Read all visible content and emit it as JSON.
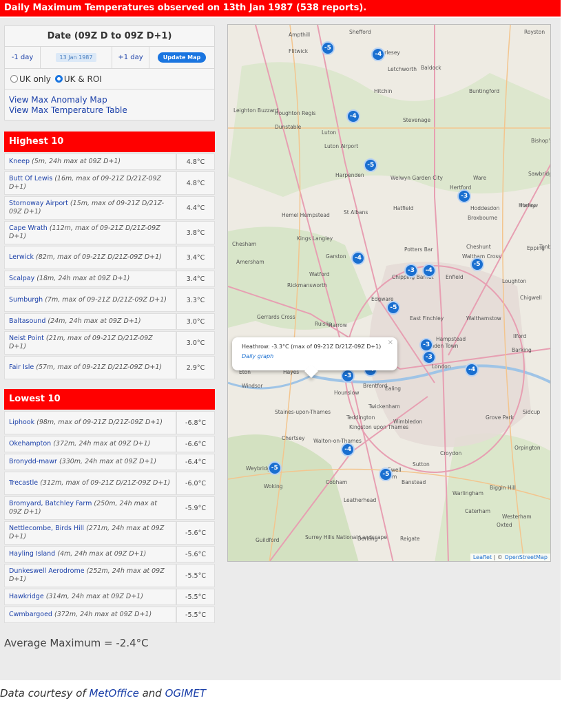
{
  "title": "Daily Maximum Temperatures observed on 13th Jan 1987 (538 reports).",
  "date_panel": {
    "heading": "Date (09Z D to 09Z D+1)",
    "prev": "-1 day",
    "date": "13 Jan 1987",
    "next": "+1 day",
    "update": "Update Map"
  },
  "region": {
    "opt1": "UK only",
    "opt2": "UK & ROI",
    "selected": "UK & ROI"
  },
  "links": {
    "anomaly": "View Max Anomaly Map",
    "table": "View Max Temperature Table"
  },
  "highest": {
    "heading": "Highest 10",
    "rows": [
      {
        "name": "Kneep",
        "desc": "(5m, 24h max at 09Z D+1)",
        "value": "4.8°C"
      },
      {
        "name": "Butt Of Lewis",
        "desc": "(16m, max of 09-21Z D/21Z-09Z D+1)",
        "value": "4.8°C"
      },
      {
        "name": "Stornoway Airport",
        "desc": "(15m, max of 09-21Z D/21Z-09Z D+1)",
        "value": "4.4°C"
      },
      {
        "name": "Cape Wrath",
        "desc": "(112m, max of 09-21Z D/21Z-09Z D+1)",
        "value": "3.8°C"
      },
      {
        "name": "Lerwick",
        "desc": "(82m, max of 09-21Z D/21Z-09Z D+1)",
        "value": "3.4°C"
      },
      {
        "name": "Scalpay",
        "desc": "(18m, 24h max at 09Z D+1)",
        "value": "3.4°C"
      },
      {
        "name": "Sumburgh",
        "desc": "(7m, max of 09-21Z D/21Z-09Z D+1)",
        "value": "3.3°C"
      },
      {
        "name": "Baltasound",
        "desc": "(24m, 24h max at 09Z D+1)",
        "value": "3.0°C"
      },
      {
        "name": "Neist Point",
        "desc": "(21m, max of 09-21Z D/21Z-09Z D+1)",
        "value": "3.0°C"
      },
      {
        "name": "Fair Isle",
        "desc": "(57m, max of 09-21Z D/21Z-09Z D+1)",
        "value": "2.9°C"
      }
    ]
  },
  "lowest": {
    "heading": "Lowest 10",
    "rows": [
      {
        "name": "Liphook",
        "desc": "(98m, max of 09-21Z D/21Z-09Z D+1)",
        "value": "-6.8°C"
      },
      {
        "name": "Okehampton",
        "desc": "(372m, 24h max at 09Z D+1)",
        "value": "-6.6°C"
      },
      {
        "name": "Bronydd-mawr",
        "desc": "(330m, 24h max at 09Z D+1)",
        "value": "-6.4°C"
      },
      {
        "name": "Trecastle",
        "desc": "(312m, max of 09-21Z D/21Z-09Z D+1)",
        "value": "-6.0°C"
      },
      {
        "name": "Bromyard, Batchley Farm",
        "desc": "(250m, 24h max at 09Z D+1)",
        "value": "-5.9°C"
      },
      {
        "name": "Nettlecombe, Birds Hill",
        "desc": "(271m, 24h max at 09Z D+1)",
        "value": "-5.6°C"
      },
      {
        "name": "Hayling Island",
        "desc": "(4m, 24h max at 09Z D+1)",
        "value": "-5.6°C"
      },
      {
        "name": "Dunkeswell Aerodrome",
        "desc": "(252m, 24h max at 09Z D+1)",
        "value": "-5.5°C"
      },
      {
        "name": "Hawkridge",
        "desc": "(314m, 24h max at 09Z D+1)",
        "value": "-5.5°C"
      },
      {
        "name": "Cwmbargoed",
        "desc": "(372m, 24h max at 09Z D+1)",
        "value": "-5.5°C"
      }
    ]
  },
  "average": "Average Maximum = -2.4°C",
  "popup": {
    "text": "Heathrow: -3.3°C (max of 09-21Z D/21Z-09Z D+1)",
    "link": "Daily graph"
  },
  "attribution": {
    "leaflet": "Leaflet",
    "sep": " | © ",
    "osm": "OpenStreetMap"
  },
  "footer": {
    "prefix": "Data courtesy of ",
    "metoffice": "MetOffice",
    "and": " and ",
    "ogimet": "OGIMET"
  },
  "map_places": [
    "Ampthill",
    "Shefford",
    "Flitwick",
    "Arlesey",
    "Letchworth",
    "Hitchin",
    "Baldock",
    "Buntingford",
    "Houghton Regis",
    "Dunstable",
    "Luton",
    "Stevenage",
    "Harpenden",
    "Welwyn Garden City",
    "Hertford",
    "Ware",
    "Hemel Hempstead",
    "St Albans",
    "Hatfield",
    "Hoddesdon",
    "Broxbourne",
    "Harlow",
    "Chesham",
    "Kings Langley",
    "Potters Bar",
    "Cheshunt",
    "Epping",
    "Amersham",
    "Garston",
    "Watford",
    "Waltham Cross",
    "Chipping Barnet",
    "Enfield",
    "Rickmansworth",
    "Loughton",
    "Edgware",
    "Chigwell",
    "Gerrards Cross",
    "Ruislip",
    "Harrow",
    "East Finchley",
    "Walthamstow",
    "Hampstead",
    "Camden Town",
    "Ilford",
    "Barking",
    "Windsor",
    "Hounslow",
    "Brentford",
    "Ealing",
    "London",
    "Twickenham",
    "Staines-upon-Thames",
    "Teddington",
    "Kingston upon Thames",
    "Wimbledon",
    "Grove Park",
    "Sidcup",
    "Orpington",
    "Croydon",
    "Ewell",
    "Sutton",
    "Epsom",
    "Chertsey",
    "Walton-on-Thames",
    "Weybridge",
    "Cobham",
    "Woking",
    "Leatherhead",
    "Banstead",
    "Warlingham",
    "Biggin Hill",
    "Caterham",
    "Westerham",
    "Oxted",
    "Guildford",
    "Dorking",
    "Reigate",
    "Surrey Hills National Landscape",
    "Bishop's Stortford",
    "Sawbridgeworth",
    "Horley",
    "Tonbridge",
    "Luton Airport",
    "Leighton Buzzard",
    "Slough",
    "Royston",
    "Eton",
    "Hayes"
  ],
  "markers": [
    {
      "label": "-5",
      "lat": 52.01,
      "lon": -0.53
    },
    {
      "label": "-4",
      "lat": 52.0,
      "lon": -0.33
    },
    {
      "label": "-4",
      "lat": 51.9,
      "lon": -0.43
    },
    {
      "label": "-5",
      "lat": 51.82,
      "lon": -0.36
    },
    {
      "label": "-3",
      "lat": 51.77,
      "lon": 0.01
    },
    {
      "label": "-4",
      "lat": 51.67,
      "lon": -0.41
    },
    {
      "label": "-3",
      "lat": 51.65,
      "lon": -0.2
    },
    {
      "label": "-4",
      "lat": 51.65,
      "lon": -0.13
    },
    {
      "label": "-5",
      "lat": 51.66,
      "lon": 0.06
    },
    {
      "label": "-5",
      "lat": 51.59,
      "lon": -0.27
    },
    {
      "label": "-3",
      "lat": 51.53,
      "lon": -0.14
    },
    {
      "label": "-3",
      "lat": 51.51,
      "lon": -0.13
    },
    {
      "label": "-3",
      "lat": 51.48,
      "lon": -0.45
    },
    {
      "label": "-4",
      "lat": 51.49,
      "lon": -0.36
    },
    {
      "label": "-4",
      "lat": 51.49,
      "lon": 0.04
    },
    {
      "label": "-4",
      "lat": 51.36,
      "lon": -0.45
    },
    {
      "label": "-5",
      "lat": 51.33,
      "lon": -0.74
    },
    {
      "label": "-5",
      "lat": 51.32,
      "lon": -0.3
    }
  ],
  "colors": {
    "header_red": "#ff0000",
    "marker_blue": "#1a6fd0",
    "link_blue": "#1a3fa8",
    "update_blue": "#1a75e0"
  }
}
